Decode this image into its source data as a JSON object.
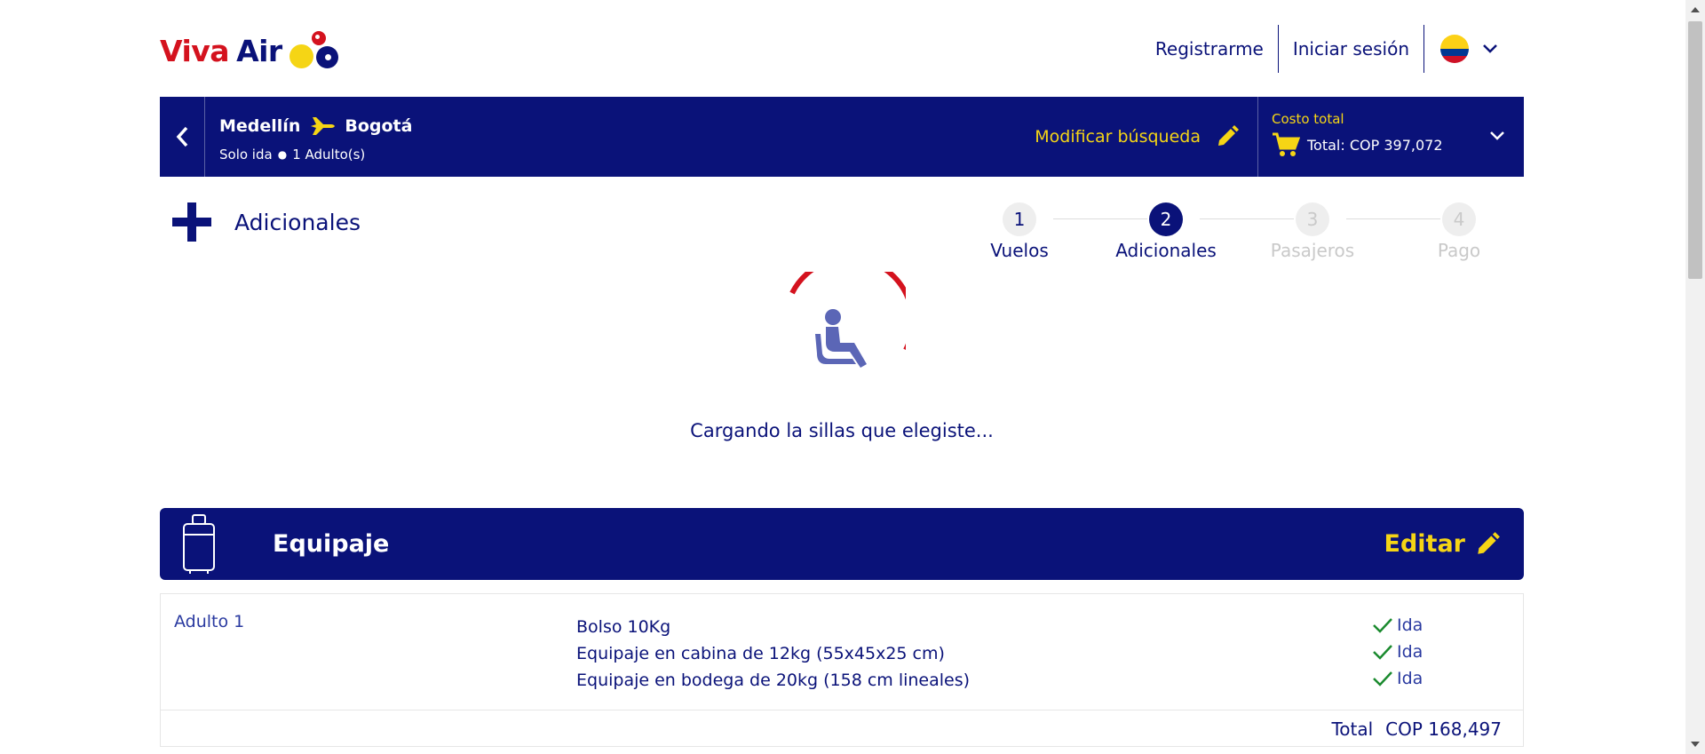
{
  "brand": {
    "viva": "Viva",
    "air": "Air"
  },
  "nav": {
    "register": "Registrarme",
    "login": "Iniciar sesión",
    "flag_icon": "colombia-flag-icon"
  },
  "search": {
    "origin": "Medellín",
    "destination": "Bogotá",
    "trip_type": "Solo ida",
    "passengers": "1 Adulto(s)",
    "modify": "Modificar búsqueda",
    "total_label": "Costo total",
    "total_value": "Total: COP 397,072"
  },
  "section": {
    "title": "Adicionales"
  },
  "steps": [
    {
      "number": "1",
      "label": "Vuelos",
      "state": "done"
    },
    {
      "number": "2",
      "label": "Adicionales",
      "state": "active"
    },
    {
      "number": "3",
      "label": "Pasajeros",
      "state": "pending"
    },
    {
      "number": "4",
      "label": "Pago",
      "state": "pending"
    }
  ],
  "loader": {
    "message": "Cargando la sillas que elegiste...",
    "icon": "seat-icon"
  },
  "baggage": {
    "title": "Equipaje",
    "edit": "Editar",
    "passenger": "Adulto 1",
    "items": [
      "Bolso 10Kg",
      "Equipaje en cabina de 12kg (55x45x25 cm)",
      "Equipaje en bodega de 20kg (158 cm lineales)"
    ],
    "statuses": [
      "Ida",
      "Ida",
      "Ida"
    ],
    "total_label": "Total",
    "total_value": "COP 168,497"
  },
  "colors": {
    "navy": "#0a1279",
    "yellow": "#f5d515",
    "red": "#d4121e",
    "green": "#1a8a2e"
  }
}
